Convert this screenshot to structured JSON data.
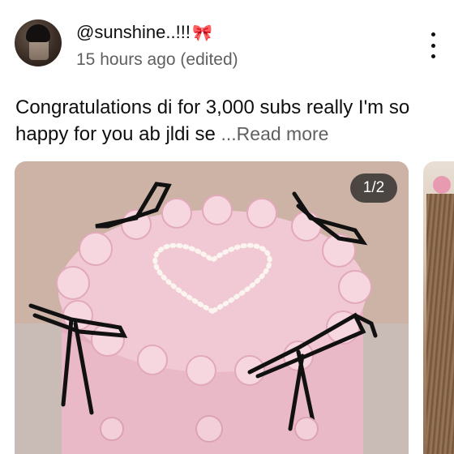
{
  "comment": {
    "username": "@sunshine..!!!",
    "username_badge": "🎀",
    "timestamp": "15 hours ago (edited)",
    "text": "Congratulations di for 3,000 subs really I'm so happy for you ab jldi se",
    "read_more": "...Read more"
  },
  "media": {
    "counter": "1/2",
    "main_image": "pink-cake-with-black-bows",
    "next_image": "braided-hair-photo"
  },
  "icons": {
    "menu": "more-vertical-icon",
    "badge": "bow-icon"
  },
  "colors": {
    "text": "#0f0f0f",
    "secondary_text": "#606060",
    "badge": "#e53950",
    "cake": "#f2cbd6",
    "ribbon": "#111111"
  }
}
